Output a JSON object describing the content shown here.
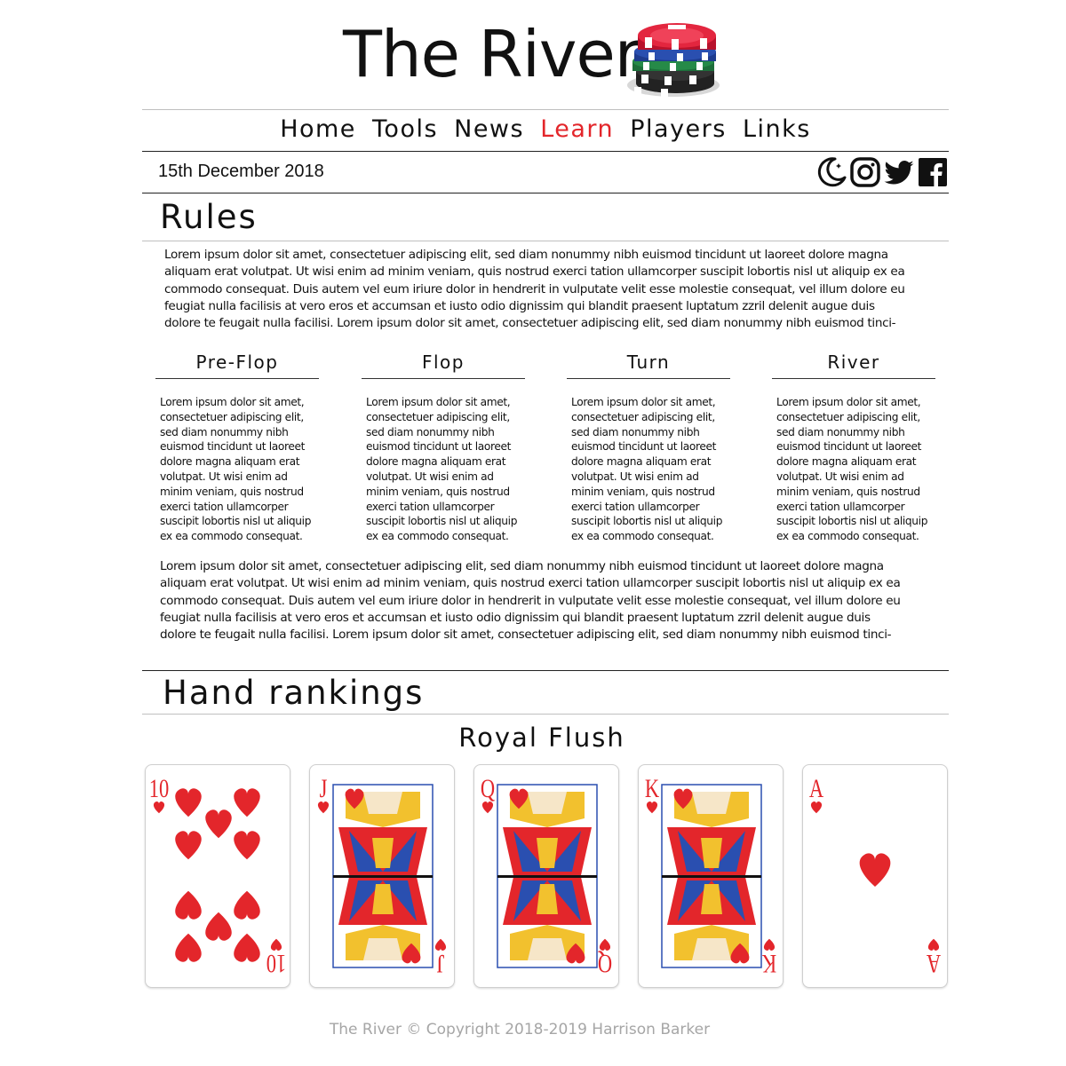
{
  "header": {
    "title": "The River",
    "logo_icon": "poker-chips-icon"
  },
  "nav": {
    "items": [
      {
        "label": "Home",
        "active": false
      },
      {
        "label": "Tools",
        "active": false
      },
      {
        "label": "News",
        "active": false
      },
      {
        "label": "Learn",
        "active": true
      },
      {
        "label": "Players",
        "active": false
      },
      {
        "label": "Links",
        "active": false
      }
    ],
    "active_color": "#e3262b"
  },
  "date": "15th December 2018",
  "social": {
    "icons": [
      "moon-icon",
      "instagram-icon",
      "twitter-icon",
      "facebook-icon"
    ]
  },
  "rules": {
    "title": "Rules",
    "intro_lines": [
      "Lorem ipsum dolor sit amet, consectetuer adipiscing elit, sed diam nonummy nibh euismod tincidunt ut laoreet dolore magna",
      "aliquam erat volutpat. Ut wisi enim ad minim veniam, quis nostrud exerci tation ullamcorper suscipit lobortis nisl ut aliquip ex ea",
      "commodo consequat. Duis autem vel eum iriure dolor in hendrerit in vulputate velit esse molestie consequat, vel illum dolore eu",
      "feugiat nulla facilisis at vero eros et accumsan et iusto odio dignissim qui blandit praesent luptatum zzril delenit augue duis",
      "dolore te feugait nulla facilisi. Lorem ipsum dolor sit amet, consectetuer adipiscing elit, sed diam nonummy nibh euismod tinci-"
    ],
    "stages": [
      {
        "name": "Pre-Flop"
      },
      {
        "name": "Flop"
      },
      {
        "name": "Turn"
      },
      {
        "name": "River"
      }
    ],
    "stage_text_lines": [
      "Lorem ipsum dolor sit amet,",
      "consectetuer adipiscing elit,",
      "sed diam nonummy nibh",
      "euismod tincidunt ut laoreet",
      "dolore magna aliquam erat",
      "volutpat. Ut wisi enim ad",
      "minim veniam, quis nostrud",
      "exerci tation ullamcorper",
      "suscipit lobortis nisl ut aliquip",
      "ex ea commodo consequat."
    ],
    "outro_lines": [
      "Lorem ipsum dolor sit amet, consectetuer adipiscing elit, sed diam nonummy nibh euismod tincidunt ut laoreet dolore magna",
      "aliquam erat volutpat. Ut wisi enim ad minim veniam, quis nostrud exerci tation ullamcorper suscipit lobortis nisl ut aliquip ex ea",
      "commodo consequat. Duis autem vel eum iriure dolor in hendrerit in vulputate velit esse molestie consequat, vel illum dolore eu",
      "feugiat nulla facilisis at vero eros et accumsan et iusto odio dignissim qui blandit praesent luptatum zzril delenit augue duis",
      "dolore te feugait nulla facilisi. Lorem ipsum dolor sit amet, consectetuer adipiscing elit, sed diam nonummy nibh euismod tinci-"
    ]
  },
  "hand_rankings": {
    "title": "Hand rankings",
    "hand_name": "Royal Flush",
    "suit_color": "#e3262b",
    "cards": [
      {
        "rank": "10",
        "suit": "hearts"
      },
      {
        "rank": "J",
        "suit": "hearts"
      },
      {
        "rank": "Q",
        "suit": "hearts"
      },
      {
        "rank": "K",
        "suit": "hearts"
      },
      {
        "rank": "A",
        "suit": "hearts"
      }
    ]
  },
  "footer": {
    "text": "The River © Copyright 2018-2019 Harrison Barker"
  }
}
